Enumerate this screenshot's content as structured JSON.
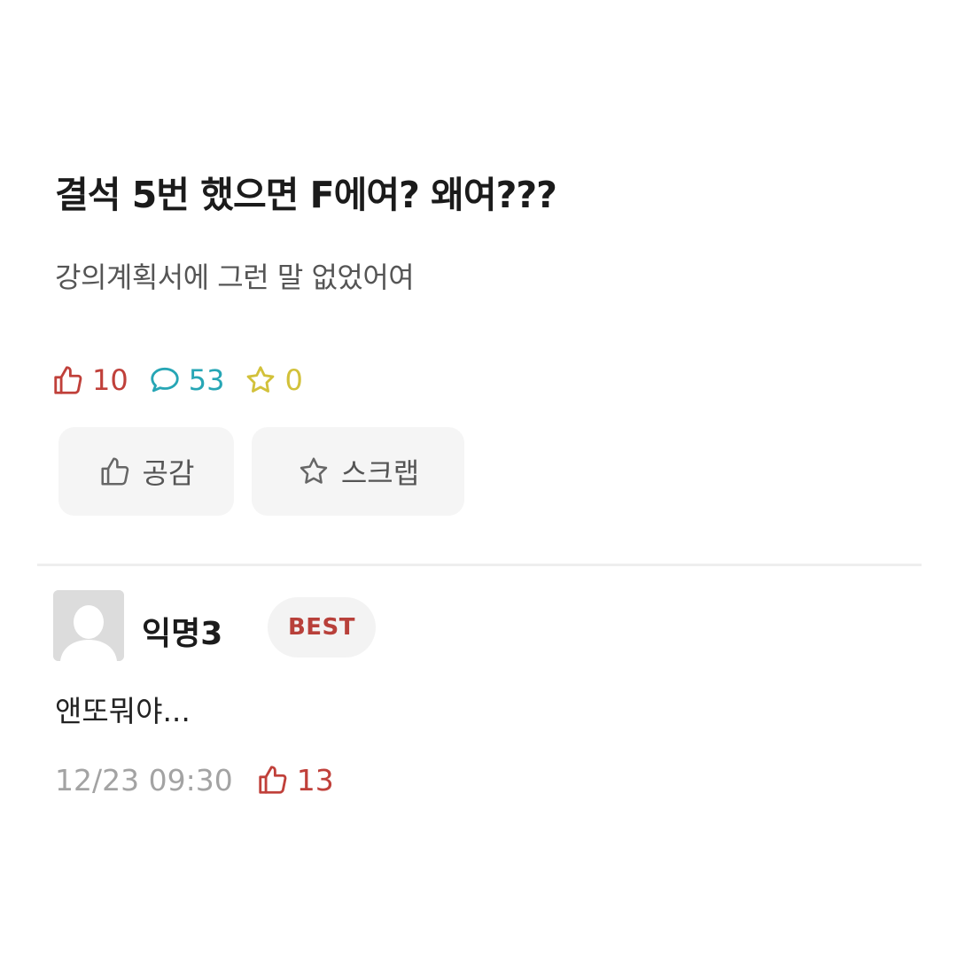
{
  "post": {
    "title": "결석 5번 했으면 F에여? 왜여???",
    "body": "강의계획서에 그런 말 없었어여",
    "stats": {
      "likes": "10",
      "comments": "53",
      "scraps": "0"
    },
    "actions": {
      "empathy_label": "공감",
      "scrap_label": "스크랩"
    }
  },
  "comment": {
    "author": "익명3",
    "badge": "BEST",
    "text": "앤또뭐야...",
    "time": "12/23 09:30",
    "likes": "13"
  },
  "icons": {
    "like": "thumbs-up-icon",
    "comment": "speech-bubble-icon",
    "scrap": "star-icon",
    "avatar": "default-avatar-icon"
  },
  "colors": {
    "like": "#c0403a",
    "comment": "#26a6b5",
    "scrap": "#d2c13a",
    "badge_text": "#b8403a",
    "muted": "#a3a3a3"
  }
}
